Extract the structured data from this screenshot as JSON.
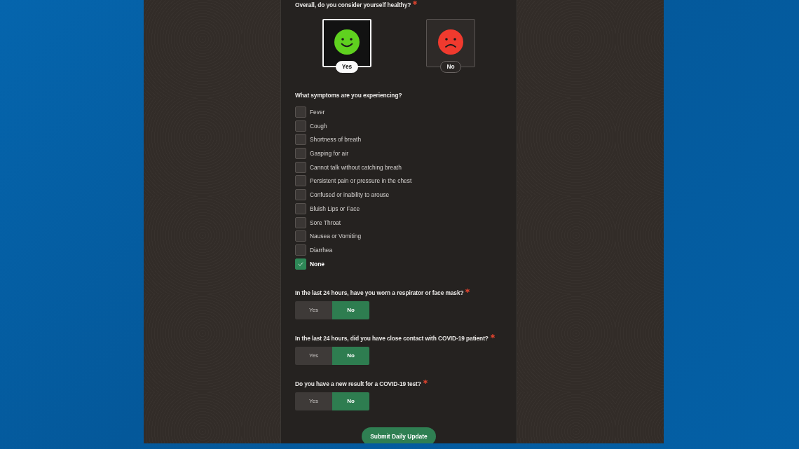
{
  "sections": [
    {
      "kind": "faces",
      "question": "Overall, do you consider yourself healthy?",
      "required": true,
      "options": [
        {
          "label": "Yes",
          "kind": "happy",
          "selected": true
        },
        {
          "label": "No",
          "kind": "sad",
          "selected": false
        }
      ]
    },
    {
      "kind": "checklist",
      "question": "What symptoms are you experiencing?",
      "required": false,
      "options": [
        {
          "label": "Fever",
          "checked": false
        },
        {
          "label": "Cough",
          "checked": false
        },
        {
          "label": "Shortness of breath",
          "checked": false
        },
        {
          "label": "Gasping for air",
          "checked": false
        },
        {
          "label": "Cannot talk without catching breath",
          "checked": false
        },
        {
          "label": "Persistent pain or pressure in the chest",
          "checked": false
        },
        {
          "label": "Confused or inability to arouse",
          "checked": false
        },
        {
          "label": "Bluish Lips or Face",
          "checked": false
        },
        {
          "label": "Sore Throat",
          "checked": false
        },
        {
          "label": "Nausea or Vomiting",
          "checked": false
        },
        {
          "label": "Diarrhea",
          "checked": false
        },
        {
          "label": "None",
          "checked": true
        }
      ]
    },
    {
      "kind": "toggle",
      "question": "In the last 24 hours, have you worn a respirator or face mask?",
      "required": true,
      "options": [
        {
          "label": "Yes",
          "selected": false
        },
        {
          "label": "No",
          "selected": true
        }
      ]
    },
    {
      "kind": "toggle",
      "question": "In the last 24 hours, did you have close contact with COVID-19 patient?",
      "required": true,
      "options": [
        {
          "label": "Yes",
          "selected": false
        },
        {
          "label": "No",
          "selected": true
        }
      ]
    },
    {
      "kind": "toggle",
      "question": "Do you have a new result for a COVID-19 test?",
      "required": true,
      "options": [
        {
          "label": "Yes",
          "selected": false
        },
        {
          "label": "No",
          "selected": true
        }
      ]
    }
  ],
  "submit": "Submit Daily Update"
}
